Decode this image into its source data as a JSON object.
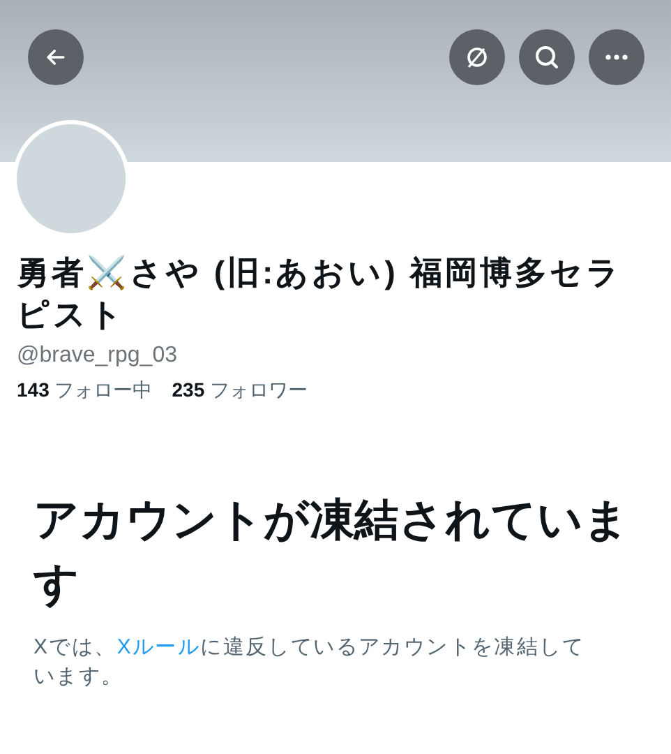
{
  "header": {
    "buttons": [
      {
        "kind": "back"
      },
      {
        "kind": "grok"
      },
      {
        "kind": "search"
      },
      {
        "kind": "more"
      }
    ]
  },
  "profile": {
    "name": "勇者⚔️さや (旧:あおい) 福岡博多セラピスト",
    "handle": "@brave_rpg_03",
    "stats": [
      {
        "count": "143",
        "label": "フォロー中"
      },
      {
        "count": "235",
        "label": "フォロワー"
      }
    ]
  },
  "notice": {
    "title": "アカウントが凍結されています",
    "before": "Xでは、",
    "link": "Xルール",
    "after": "に違反しているアカウントを凍結しています。"
  }
}
